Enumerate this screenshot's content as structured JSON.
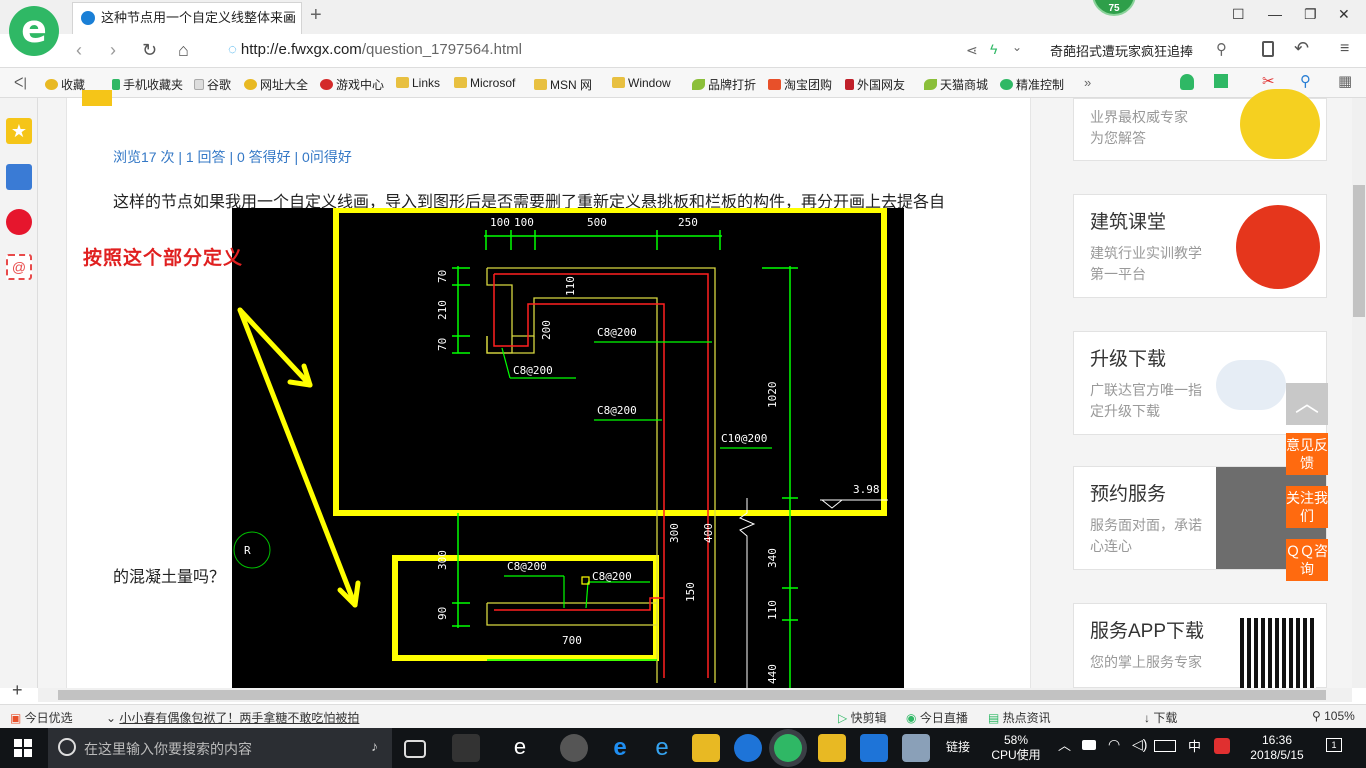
{
  "browser": {
    "tab_title": "这种节点用一个自定义线整体来画",
    "tab_close": "×",
    "new_tab": "+",
    "badge_count": "75",
    "url_scheme_host": "http://e.fwxgx.com",
    "url_path": "/question_1797564.html",
    "search_text": "奇葩招式遭玩家疯狂追捧",
    "window_controls": [
      "☐",
      "—",
      "❐",
      "✕"
    ]
  },
  "bookmarks": [
    {
      "label": "收藏",
      "icon": "star-icon",
      "color": "#e8b923"
    },
    {
      "label": "手机收藏夹",
      "icon": "phone-icon",
      "color": "#2fb865"
    },
    {
      "label": "谷歌",
      "icon": "page-icon",
      "color": "#cfcfcf"
    },
    {
      "label": "网址大全",
      "icon": "ie-icon",
      "color": "#e8b923"
    },
    {
      "label": "游戏中心",
      "icon": "game-icon",
      "color": "#d42a2a"
    },
    {
      "label": "Links",
      "icon": "folder-icon",
      "color": "#e8c040"
    },
    {
      "label": "Microsof",
      "icon": "folder-icon",
      "color": "#e8c040"
    },
    {
      "label": "MSN 网",
      "icon": "folder-icon",
      "color": "#e8c040"
    },
    {
      "label": "Window",
      "icon": "folder-icon",
      "color": "#e8c040"
    },
    {
      "label": "品牌打折",
      "icon": "leaf-icon",
      "color": "#8bbf3a"
    },
    {
      "label": "淘宝团购",
      "icon": "taobao-icon",
      "color": "#e8502a"
    },
    {
      "label": "外国网友",
      "icon": "flag-icon",
      "color": "#c0202a"
    },
    {
      "label": "天猫商城",
      "icon": "leaf-icon",
      "color": "#8bbf3a"
    },
    {
      "label": "精准控制",
      "icon": "chat-icon",
      "color": "#2fb865"
    }
  ],
  "question": {
    "stats": "浏览17 次 | 1 回答 | 0 答得好 | 0问得好",
    "text_line1": "这样的节点如果我用一个自定义线画，导入到图形后是否需要删了重新定义悬挑板和栏板的构件，再分开画上去提各自",
    "text_line2": "的混凝土量吗？",
    "annotation": "按照这个部分定义"
  },
  "cad": {
    "dims_top": [
      "100",
      "100",
      "500",
      "250"
    ],
    "dims_left": [
      "70",
      "210",
      "70"
    ],
    "dim_110": "110",
    "dim_200": "200",
    "rebar_labels": [
      "C8@200",
      "C8@200",
      "C8@200",
      "C10@200",
      "C8@200",
      "C8@200"
    ],
    "dim_1020": "1020",
    "elev": "3.98",
    "dim_300": "300",
    "dim_400": "400",
    "dim_340": "340",
    "dim_300b": "300",
    "dim_90": "90",
    "dim_150": "150",
    "dim_110b": "110",
    "dim_700": "700",
    "dim_440": "440",
    "ucs": "R"
  },
  "sidebar": {
    "top_card_text": "业界最权威专家\n为您解答",
    "cards": [
      {
        "title": "建筑课堂",
        "sub": "建筑行业实训教学第一平台"
      },
      {
        "title": "升级下载",
        "sub": "广联达官方唯一指定升级下载"
      },
      {
        "title": "预约服务",
        "sub": "服务面对面，承诺心连心"
      },
      {
        "title": "服务APP下载",
        "sub": "您的掌上服务专家"
      }
    ],
    "float_buttons": [
      "意见反馈",
      "关注我们",
      "ＱＱ咨询"
    ]
  },
  "statusbar": {
    "left_items": [
      "今日优选",
      "小小春有偶像包袱了！两手拿糖不敢吃怕被拍"
    ],
    "right_items": [
      "快剪辑",
      "今日直播",
      "热点资讯",
      "下载",
      "105%"
    ]
  },
  "taskbar": {
    "search_placeholder": "在这里输入你要搜索的内容",
    "links": "链接",
    "cpu_percent": "58%",
    "cpu_label": "CPU使用",
    "ime": "中",
    "time": "16:36",
    "date": "2018/5/15",
    "notif_count": "1"
  },
  "colors": {
    "browser_green": "#2fb865",
    "link_blue": "#3478c6",
    "accent_orange": "#ff6a0f",
    "cad_yellow": "#ffff00",
    "cad_green": "#00ff00",
    "cad_red": "#ff2020"
  }
}
